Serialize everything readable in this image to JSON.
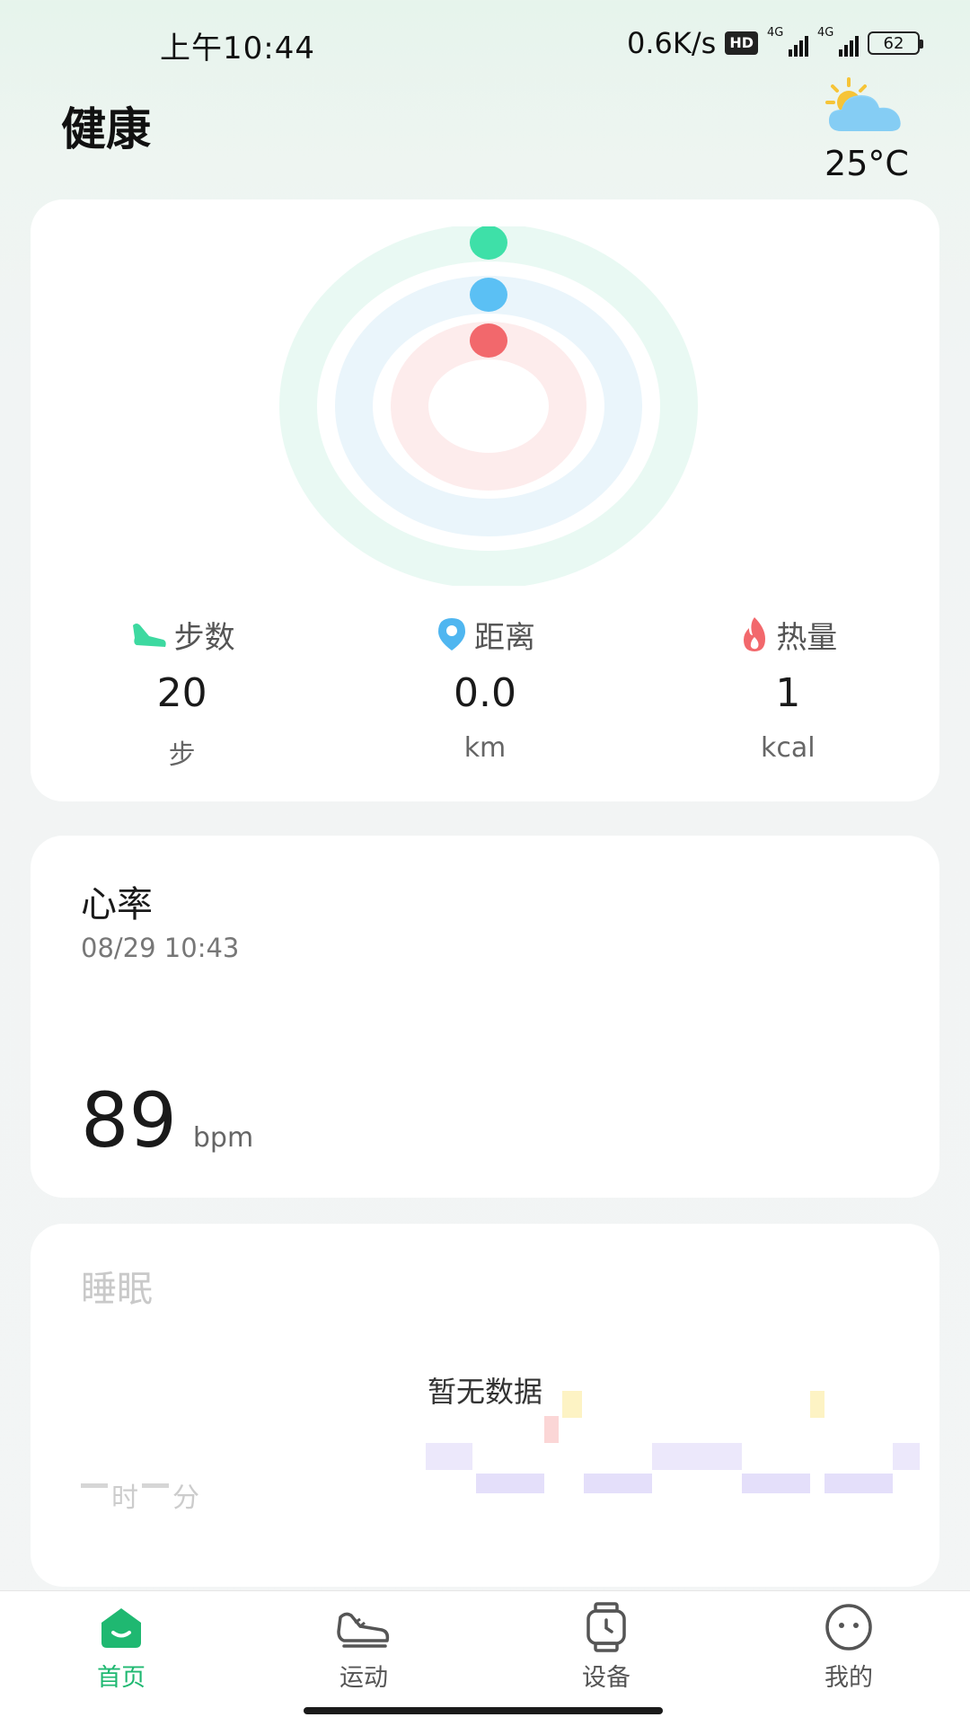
{
  "status_bar": {
    "time": "上午10:44",
    "net_speed": "0.6K/s",
    "hd_label": "HD",
    "network_1": "4G",
    "network_2": "4G",
    "battery": "62"
  },
  "header": {
    "title": "健康",
    "weather_icon": "partly-cloudy-icon",
    "temperature": "25°C"
  },
  "activity": {
    "rings": [
      {
        "name": "steps",
        "color": "#3ee0a8",
        "progress": 0
      },
      {
        "name": "distance",
        "color": "#5bc0f4",
        "progress": 0
      },
      {
        "name": "calories",
        "color": "#f2686c",
        "progress": 0
      }
    ],
    "stats": [
      {
        "label": "步数",
        "value": "20",
        "unit": "步",
        "icon": "shoe-icon",
        "color": "#3dd9a0"
      },
      {
        "label": "距离",
        "value": "0.0",
        "unit": "km",
        "icon": "location-pin-icon",
        "color": "#4fb6f0"
      },
      {
        "label": "热量",
        "value": "1",
        "unit": "kcal",
        "icon": "flame-icon",
        "color": "#f2686c"
      }
    ]
  },
  "heart_rate": {
    "title": "心率",
    "time": "08/29 10:43",
    "value": "89",
    "unit": "bpm"
  },
  "sleep": {
    "title": "睡眠",
    "empty_text": "暂无数据",
    "hours_label": "时",
    "minutes_label": "分"
  },
  "nav": {
    "items": [
      {
        "label": "首页",
        "icon": "home-icon",
        "active": true
      },
      {
        "label": "运动",
        "icon": "sneaker-icon",
        "active": false
      },
      {
        "label": "设备",
        "icon": "watch-icon",
        "active": false
      },
      {
        "label": "我的",
        "icon": "face-icon",
        "active": false
      }
    ]
  },
  "colors": {
    "accent": "#1fb871",
    "steps": "#3ee0a8",
    "distance": "#5bc0f4",
    "calories": "#f2686c"
  }
}
